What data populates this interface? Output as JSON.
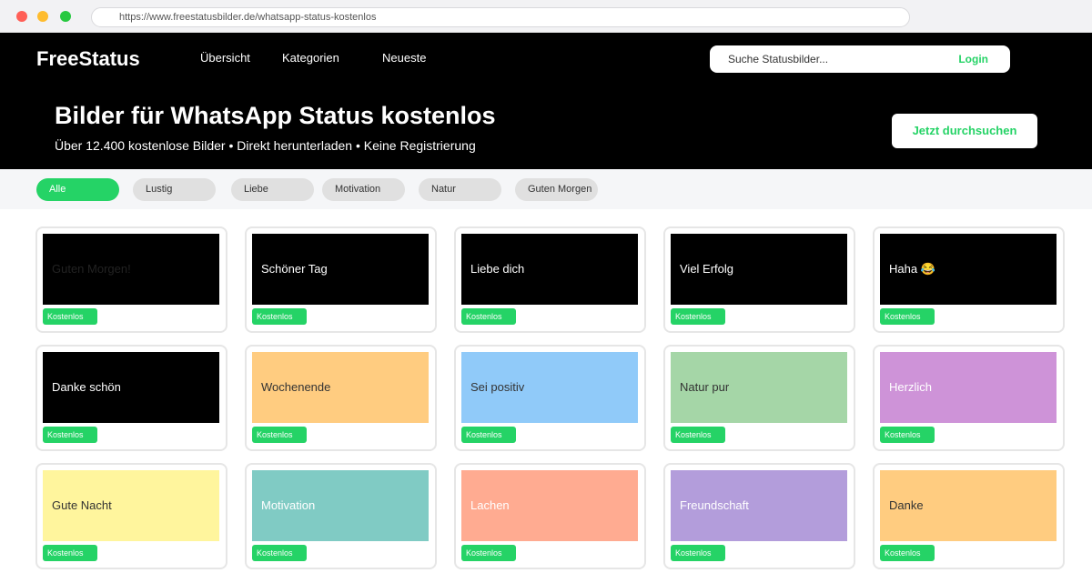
{
  "browser": {
    "url": "https://www.freestatusbilder.de/whatsapp-status-kostenlos"
  },
  "header": {
    "logo": "FreeStatus",
    "nav": [
      "Übersicht",
      "Kategorien",
      "Neueste"
    ],
    "search_placeholder": "Suche Statusbilder...",
    "login_label": "Login",
    "hero_title": "Bilder für WhatsApp Status kostenlos",
    "hero_subtitle": "Über 12.400 kostenlose Bilder • Direkt herunterladen • Keine Registrierung",
    "cta_label": "Jetzt durchsuchen"
  },
  "filters": {
    "chips": [
      "Alle",
      "Lustig",
      "Liebe",
      "Motivation",
      "Natur",
      "Guten Morgen"
    ],
    "active": "Alle"
  },
  "grid": {
    "badge_label": "Kostenlos",
    "cards": [
      {
        "label": "Guten Morgen!",
        "bg": "#000000",
        "color": "#222222"
      },
      {
        "label": "Schöner Tag",
        "bg": "#000000",
        "color": "#ffffff"
      },
      {
        "label": "Liebe dich",
        "bg": "#000000",
        "color": "#ffffff"
      },
      {
        "label": "Viel Erfolg",
        "bg": "#000000",
        "color": "#ffffff"
      },
      {
        "label": "Haha 😂",
        "bg": "#000000",
        "color": "#ffffff"
      },
      {
        "label": "Danke schön",
        "bg": "#000000",
        "color": "#ffffff"
      },
      {
        "label": "Wochenende",
        "bg": "#ffcc80",
        "color": "#333333"
      },
      {
        "label": "Sei positiv",
        "bg": "#90caf9",
        "color": "#333333"
      },
      {
        "label": "Natur pur",
        "bg": "#a5d6a7",
        "color": "#333333"
      },
      {
        "label": "Herzlich",
        "bg": "#ce93d8",
        "color": "#ffffff"
      },
      {
        "label": "Gute Nacht",
        "bg": "#fff59d",
        "color": "#333333"
      },
      {
        "label": "Motivation",
        "bg": "#80cbc4",
        "color": "#ffffff"
      },
      {
        "label": "Lachen",
        "bg": "#ffab91",
        "color": "#ffffff"
      },
      {
        "label": "Freundschaft",
        "bg": "#b39ddb",
        "color": "#ffffff"
      },
      {
        "label": "Danke",
        "bg": "#ffcc80",
        "color": "#333333"
      }
    ]
  },
  "colors": {
    "accent": "#25d366",
    "header_bg": "#000000",
    "chip_bg": "#e0e0e0"
  }
}
